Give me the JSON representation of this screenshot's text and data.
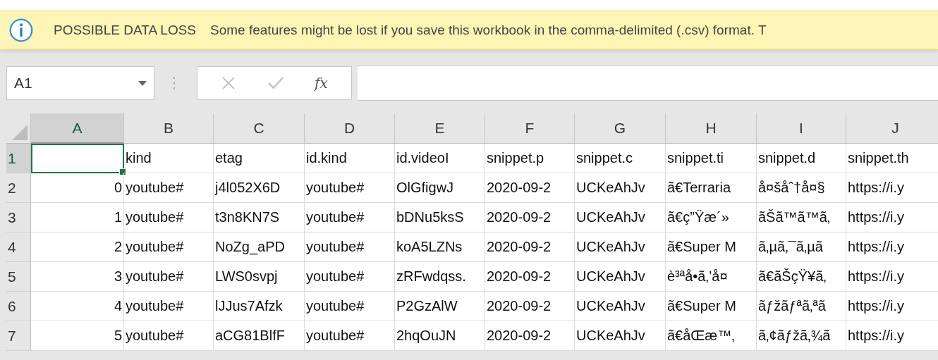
{
  "message_bar": {
    "title": "POSSIBLE DATA LOSS",
    "message": "Some features might be lost if you save this workbook in the comma-delimited (.csv) format. T"
  },
  "formula_bar": {
    "name_box": "A1",
    "function_button": "fx"
  },
  "columns": [
    {
      "label": "A",
      "selected": true
    },
    {
      "label": "B",
      "selected": false
    },
    {
      "label": "C",
      "selected": false
    },
    {
      "label": "D",
      "selected": false
    },
    {
      "label": "E",
      "selected": false
    },
    {
      "label": "F",
      "selected": false
    },
    {
      "label": "G",
      "selected": false
    },
    {
      "label": "H",
      "selected": false
    },
    {
      "label": "I",
      "selected": false
    },
    {
      "label": "J",
      "selected": false
    }
  ],
  "rows": [
    {
      "number": "1",
      "selected": true,
      "cells": [
        "",
        "kind",
        "etag",
        "id.kind",
        "id.videoI",
        "snippet.p",
        "snippet.c",
        "snippet.ti",
        "snippet.d",
        "snippet.th"
      ]
    },
    {
      "number": "2",
      "selected": false,
      "cells": [
        "0",
        "youtube#",
        "j4l052X6D",
        "youtube#",
        "OlGfigwJ",
        "2020-09-2",
        "UCKeAhJv",
        "ã€Terraria",
        "å¤šåˆ†å¤§",
        "https://i.y"
      ]
    },
    {
      "number": "3",
      "selected": false,
      "cells": [
        "1",
        "youtube#",
        "t3n8KN7S",
        "youtube#",
        "bDNu5ksS",
        "2020-09-2",
        "UCKeAhJv",
        "ã€ç”Ÿæ´»",
        "ãŠã™ã™ã‚",
        "https://i.y"
      ]
    },
    {
      "number": "4",
      "selected": false,
      "cells": [
        "2",
        "youtube#",
        "NoZg_aPD",
        "youtube#",
        "koA5LZNs",
        "2020-09-2",
        "UCKeAhJv",
        "ã€Super M",
        "ã‚µã‚¯ã‚µã",
        "https://i.y"
      ]
    },
    {
      "number": "5",
      "selected": false,
      "cells": [
        "3",
        "youtube#",
        "LWS0svpj",
        "youtube#",
        "zRFwdqss.",
        "2020-09-2",
        "UCKeAhJv",
        "è³ªå•ã‚’å¤",
        "ã€ãŠçŸ¥ã‚",
        "https://i.y"
      ]
    },
    {
      "number": "6",
      "selected": false,
      "cells": [
        "4",
        "youtube#",
        "lJJus7Afzk",
        "youtube#",
        "P2GzAlW",
        "2020-09-2",
        "UCKeAhJv",
        "ã€Super M",
        "ãƒžãƒªã‚ªã",
        "https://i.y"
      ]
    },
    {
      "number": "7",
      "selected": false,
      "cells": [
        "5",
        "youtube#",
        "aCG81BlfF",
        "youtube#",
        "2hqOuJN",
        "2020-09-2",
        "UCKeAhJv",
        "ã€åŒæ™‚",
        "ã‚¢ãƒžã‚¾ã",
        "https://i.y"
      ]
    }
  ]
}
